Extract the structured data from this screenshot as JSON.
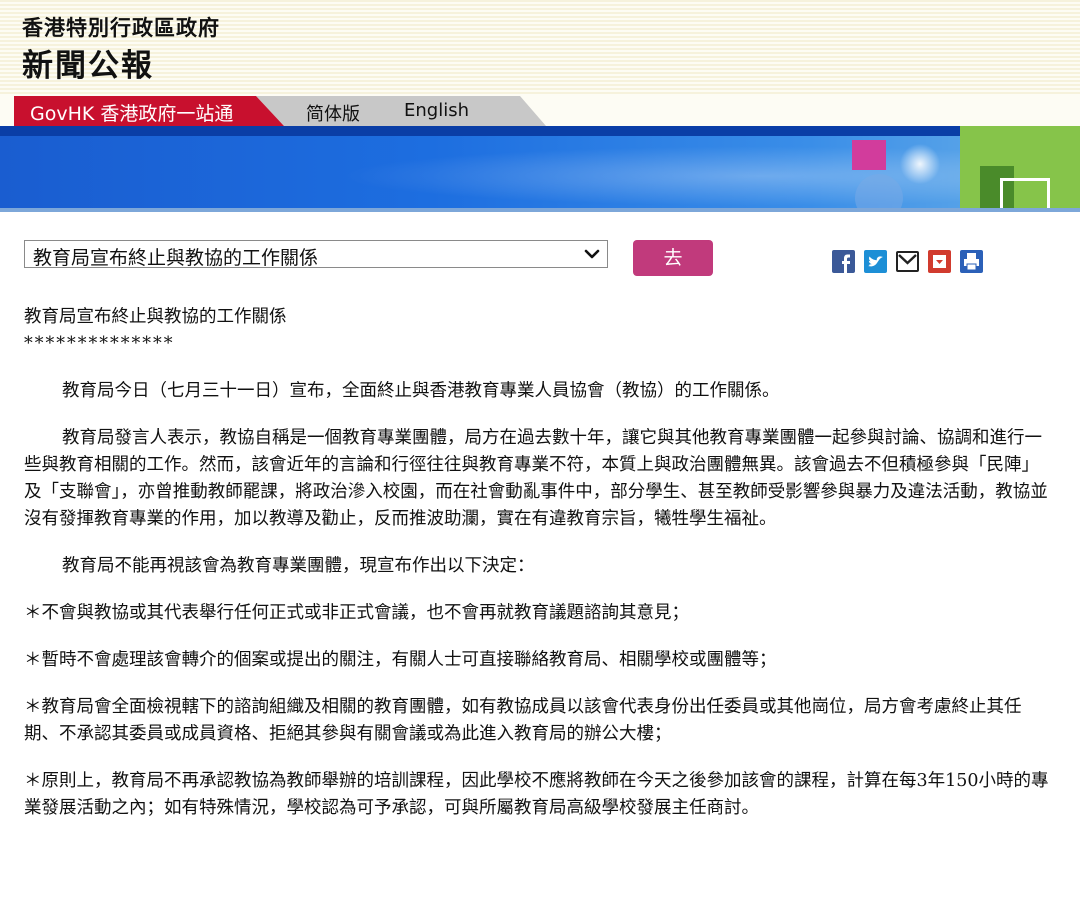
{
  "header": {
    "org": "香港特別行政區政府",
    "title": "新聞公報"
  },
  "nav": {
    "govhk": "GovHK 香港政府一站通",
    "simplified": "简体版",
    "english": "English"
  },
  "toolbar": {
    "selected_article": "教育局宣布終止與教協的工作關係",
    "go_label": "去"
  },
  "share_icons": [
    "facebook-icon",
    "twitter-icon",
    "mail-icon",
    "bookmark-icon",
    "print-icon"
  ],
  "colors": {
    "govhk_red": "#c8102e",
    "go_button": "#c13a7c",
    "banner_blue": "#1d6ee0"
  },
  "article": {
    "headline": "教育局宣布終止與教協的工作關係",
    "stars": "**************",
    "para1": "教育局今日（七月三十一日）宣布，全面終止與香港教育專業人員協會（教協）的工作關係。",
    "para2": "教育局發言人表示，教協自稱是一個教育專業團體，局方在過去數十年，讓它與其他教育專業團體一起參與討論、協調和進行一些與教育相關的工作。然而，該會近年的言論和行徑往往與教育專業不符，本質上與政治團體無異。該會過去不但積極參與「民陣」及「支聯會」，亦曾推動教師罷課，將政治滲入校園，而在社會動亂事件中，部分學生、甚至教師受影響參與暴力及違法活動，教協並沒有發揮教育專業的作用，加以教導及勸止，反而推波助瀾，實在有違教育宗旨，犧牲學生福祉。",
    "para3": "教育局不能再視該會為教育專業團體，現宣布作出以下決定：",
    "point1": "＊不會與教協或其代表舉行任何正式或非正式會議，也不會再就教育議題諮詢其意見；",
    "point2": "＊暫時不會處理該會轉介的個案或提出的關注，有關人士可直接聯絡教育局、相關學校或團體等；",
    "point3": "＊教育局會全面檢視轄下的諮詢組織及相關的教育團體，如有教協成員以該會代表身份出任委員或其他崗位，局方會考慮終止其任期、不承認其委員或成員資格、拒絕其參與有關會議或為此進入教育局的辦公大樓；",
    "point4": "＊原則上，教育局不再承認教協為教師舉辦的培訓課程，因此學校不應將教師在今天之後參加該會的課程，計算在每3年150小時的專業發展活動之內；如有特殊情況，學校認為可予承認，可與所屬教育局高級學校發展主任商討。"
  }
}
